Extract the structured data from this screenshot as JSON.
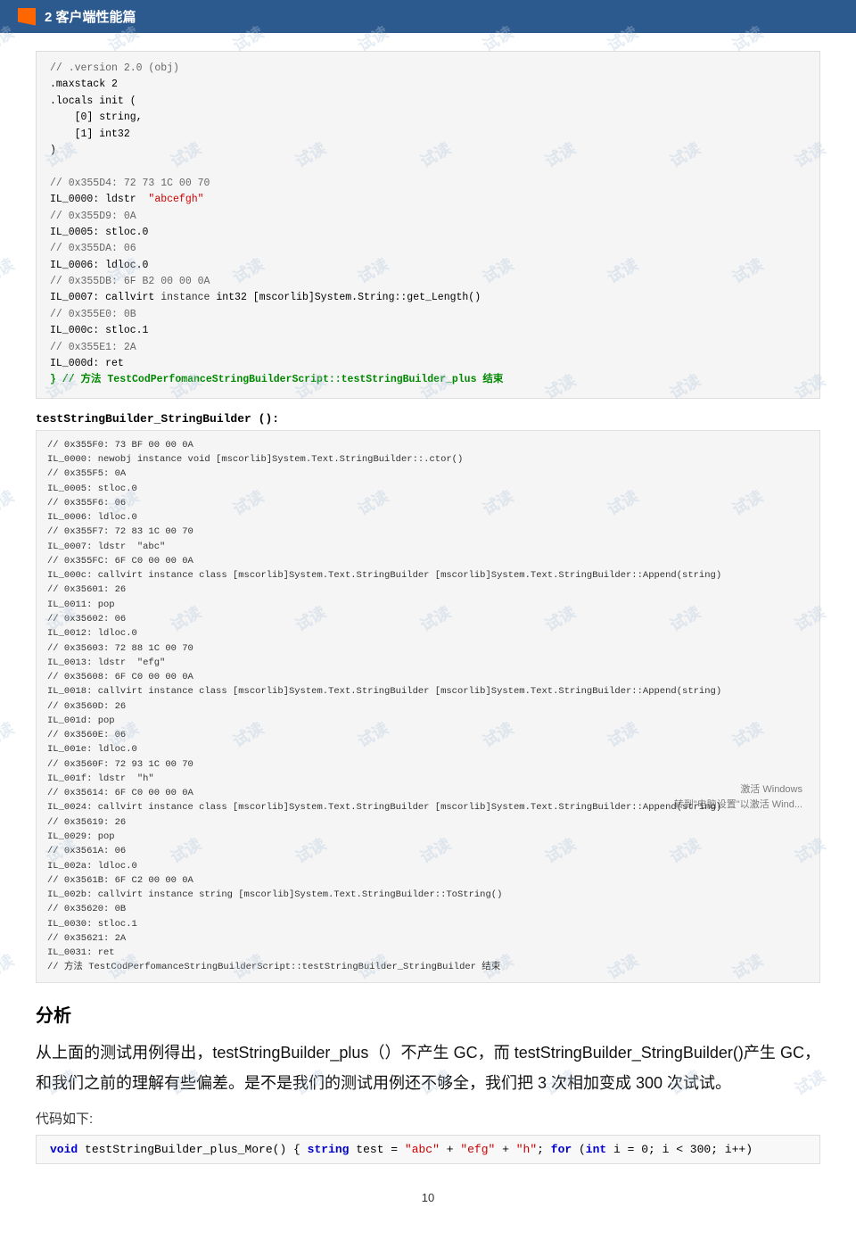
{
  "header": {
    "title": "2 客户端性能篇",
    "icon": "book-icon"
  },
  "code_block_1": {
    "lines": [
      "// .version 2.0 (obj)",
      ".maxstack 2",
      ".locals init (",
      "    [0] string,",
      "    [1] int32",
      ")",
      "",
      "// 0x355D4: 72 73 1C 00 70",
      "IL_0000: ldstr  \"abcefgh\"",
      "// 0x355D9: 0A",
      "IL_0005: stloc.0",
      "// 0x355DA: 06",
      "IL_0006: ldloc.0",
      "// 0x355DB: 6F B2 00 00 0A",
      "IL_0007: callvirt instance int32 [mscorlib]System.String::get_Length()",
      "// 0x355E0: 0B",
      "IL_000c: stloc.1",
      "// 0x355E1: 2A",
      "IL_000d: ret",
      "} // 方法 TestCodPerfomanceStringBuilderScript::testStringBuilder_plus 结束"
    ]
  },
  "func_header_2": "testStringBuilder_StringBuilder ():",
  "code_block_2": {
    "lines": [
      "// 0x355F0: 73 BF 00 00 0A",
      "IL_0000: newobj instance void [mscorlib]System.Text.StringBuilder::.ctor()",
      "// 0x355F5: 0A",
      "IL_0005: stloc.0",
      "// 0x355F6: 06",
      "IL_0006: ldloc.0",
      "// 0x355F7: 72 83 1C 00 70",
      "IL_0007: ldstr  \"abc\"",
      "// 0x355FC: 6F C0 00 00 0A",
      "IL_000c: callvirt instance class [mscorlib]System.Text.StringBuilder [mscorlib]System.Text.StringBuilder::Append(string)",
      "// 0x35601: 26",
      "IL_0011: pop",
      "// 0x35602: 06",
      "IL_0012: ldloc.0",
      "// 0x35603: 72 88 1C 00 70",
      "IL_0013: ldstr  \"efg\"",
      "// 0x35608: 6F C0 00 00 0A",
      "IL_0018: callvirt instance class [mscorlib]System.Text.StringBuilder [mscorlib]System.Text.StringBuilder::Append(string)",
      "// 0x3560D: 26",
      "IL_001d: pop",
      "// 0x3560E: 06",
      "IL_001e: ldloc.0",
      "// 0x3560F: 72 93 1C 00 70",
      "IL_001f: ldstr  \"h\"",
      "// 0x35614: 6F C0 00 00 0A",
      "IL_0024: callvirt instance class [mscorlib]System.Text.StringBuilder [mscorlib]System.Text.StringBuilder::Append(string)",
      "// 0x35619: 26",
      "IL_0029: pop",
      "// 0x3561A: 06",
      "IL_002a: ldloc.0",
      "// 0x3561B: 6F C2 00 00 0A",
      "IL_002b: callvirt instance string [mscorlib]System.Text.StringBuilder::ToString()",
      "// 0x35620: 0B",
      "IL_0030: stloc.1",
      "// 0x35621: 2A",
      "IL_0031: ret",
      "// 方法 TestCodPerfomanceStringBuilderScript::testStringBuilder_StringBuilder 结束"
    ]
  },
  "section_analysis": {
    "title": "分析",
    "body1": "从上面的测试用例得出，testStringBuilder_plus（）不产生 GC，而 testStringBuilder_StringBuilder()产生 GC，和我们之前的理解有些偏差。是不是我们的测试用例还不够全，我们把 3 次相加变成 300 次试试。",
    "code_label": "代码如下:",
    "func_name": "void testStringBuilder_plus_More()",
    "code_lines": [
      "    {",
      "        string test = \"abc\" + \"efg\" + \"h\";",
      "        for (int i = 0; i < 300; i++)"
    ]
  },
  "page_number": "10",
  "win_activate_line1": "激活 Windows",
  "win_activate_line2": "转到\"电脑设置\"以激活 Wind..."
}
